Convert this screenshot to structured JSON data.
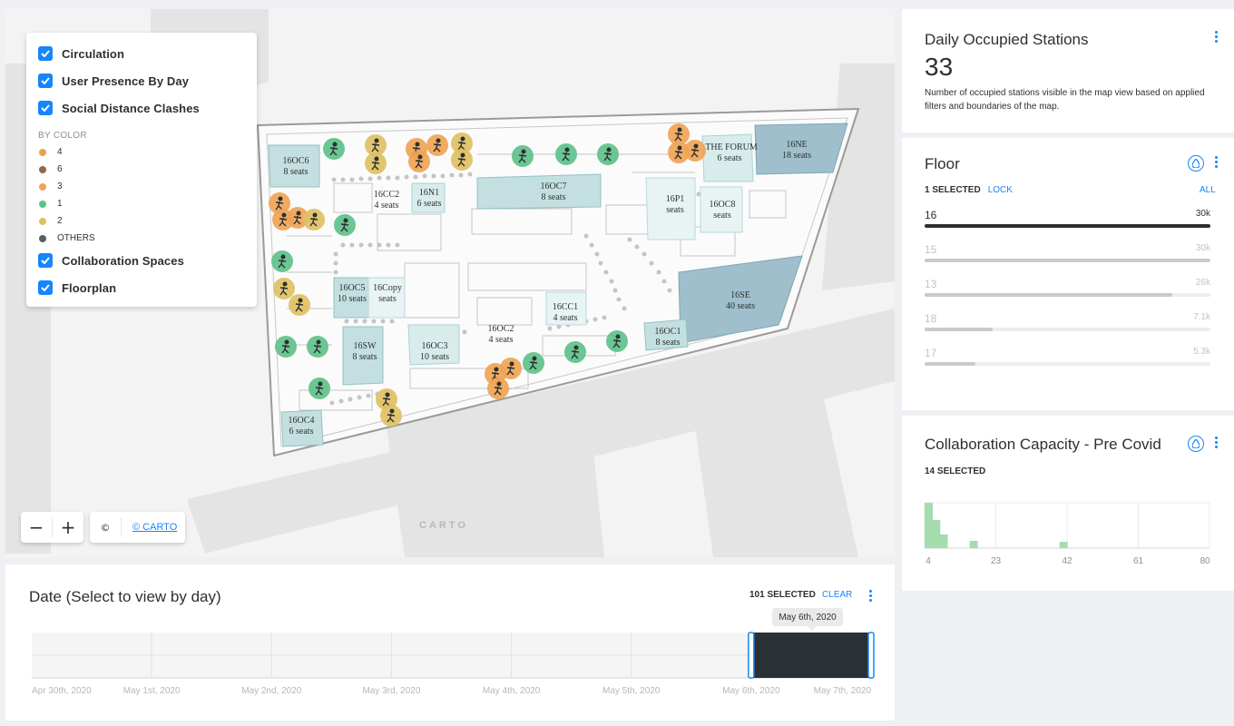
{
  "legend": {
    "layers_top": [
      {
        "label": "Circulation"
      },
      {
        "label": "User Presence By Day"
      },
      {
        "label": "Social Distance Clashes"
      }
    ],
    "by_color_label": "BY COLOR",
    "color_items": [
      {
        "label": "4",
        "color": "#e6a245"
      },
      {
        "label": "6",
        "color": "#8f6a4b"
      },
      {
        "label": "3",
        "color": "#f0a455"
      },
      {
        "label": "1",
        "color": "#5fc18a"
      },
      {
        "label": "2",
        "color": "#dfc062"
      },
      {
        "label": "OTHERS",
        "color": "#5a5e61"
      }
    ],
    "layers_bottom": [
      {
        "label": "Collaboration Spaces"
      },
      {
        "label": "Floorplan"
      }
    ]
  },
  "map": {
    "zoom_out": "−",
    "zoom_in": "+",
    "copyright": "©",
    "attribution": "© CARTO",
    "logo": "CARTO",
    "rooms": [
      {
        "name": "16OC6",
        "seats": "8 seats"
      },
      {
        "name": "16CC2",
        "seats": "4 seats"
      },
      {
        "name": "16N1",
        "seats": "6 seats"
      },
      {
        "name": "16OC7",
        "seats": "8 seats"
      },
      {
        "name": "THE FORUM",
        "seats": "6 seats"
      },
      {
        "name": "16NE",
        "seats": "18 seats"
      },
      {
        "name": "16P1",
        "seats": "seats"
      },
      {
        "name": "16OC8",
        "seats": "seats"
      },
      {
        "name": "16OC5",
        "seats": "10 seats"
      },
      {
        "name": "16Copy",
        "seats": "seats"
      },
      {
        "name": "16CC1",
        "seats": "4 seats"
      },
      {
        "name": "16SE",
        "seats": "40 seats"
      },
      {
        "name": "16OC2",
        "seats": "4 seats"
      },
      {
        "name": "16SW",
        "seats": "8 seats"
      },
      {
        "name": "16OC3",
        "seats": "10 seats"
      },
      {
        "name": "16OC1",
        "seats": "8 seats"
      },
      {
        "name": "16OC4",
        "seats": "6 seats"
      }
    ]
  },
  "stations": {
    "title": "Daily Occupied Stations",
    "value": "33",
    "description": "Number of occupied stations visible in the map view based on applied filters and boundaries of the map."
  },
  "floor": {
    "title": "Floor",
    "selected": "1 SELECTED",
    "lock": "LOCK",
    "all": "ALL",
    "rows": [
      {
        "name": "16",
        "label": "30k",
        "value": 30,
        "active": true
      },
      {
        "name": "15",
        "label": "30k",
        "value": 30,
        "active": false
      },
      {
        "name": "13",
        "label": "26k",
        "value": 26,
        "active": false
      },
      {
        "name": "18",
        "label": "7.1k",
        "value": 7.1,
        "active": false
      },
      {
        "name": "17",
        "label": "5.3k",
        "value": 5.3,
        "active": false
      }
    ],
    "max": 30,
    "active_color": "#2c3032",
    "inactive_color": "#c9cacb"
  },
  "collab": {
    "title": "Collaboration Capacity - Pre Covid",
    "selected": "14 SELECTED",
    "chart_data": {
      "type": "bar",
      "x_ticks": [
        "4",
        "23",
        "42",
        "61",
        "80"
      ],
      "xlim": [
        4,
        80
      ],
      "bins": [
        {
          "x": 4,
          "value": 1.0
        },
        {
          "x": 6,
          "value": 0.62
        },
        {
          "x": 8,
          "value": 0.3
        },
        {
          "x": 16,
          "value": 0.16
        },
        {
          "x": 40,
          "value": 0.14
        }
      ],
      "bar_color": "#a5dcae"
    }
  },
  "date": {
    "title": "Date (Select to view by day)",
    "selected": "101 SELECTED",
    "clear": "CLEAR",
    "tooltip": "May 6th, 2020",
    "ticks": [
      "Apr 30th, 2020",
      "May 1st, 2020",
      "May 2nd, 2020",
      "May 3rd, 2020",
      "May 4th, 2020",
      "May 5th, 2020",
      "May 6th, 2020",
      "May 7th, 2020"
    ],
    "selected_range": [
      "May 6th, 2020",
      "May 7th, 2020"
    ],
    "selected_color": "#2b3035",
    "handle_color": "#1785fb"
  }
}
